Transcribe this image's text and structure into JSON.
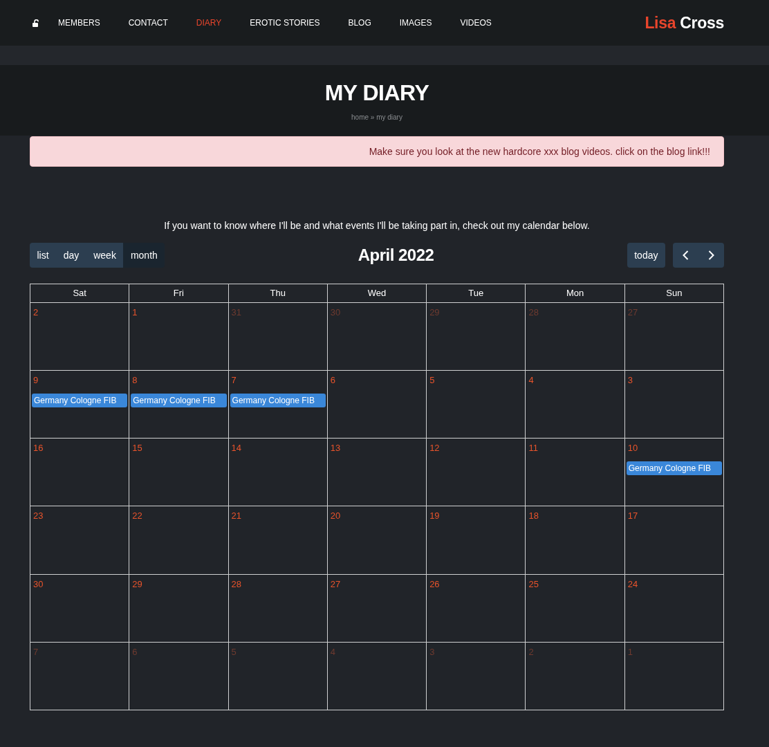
{
  "header": {
    "nav": [
      {
        "label": "MEMBERS",
        "selected": false
      },
      {
        "label": "CONTACT",
        "selected": false
      },
      {
        "label": "DIARY",
        "selected": true
      },
      {
        "label": "EROTIC STORIES",
        "selected": false
      },
      {
        "label": "BLOG",
        "selected": false
      },
      {
        "label": "IMAGES",
        "selected": false
      },
      {
        "label": "VIDEOS",
        "selected": false
      }
    ],
    "logo": {
      "accent": "Lisa",
      "text": "Cross"
    }
  },
  "banner": {
    "title": "MY DIARY",
    "breadcrumb": "home » my diary"
  },
  "alert": {
    "message": "Make sure you look at the new hardcore xxx blog videos. click on the blog link!!!"
  },
  "intro": "If you want to know where I'll be and what events I'll be taking part in, check out my calendar below.",
  "calendar": {
    "views": [
      {
        "label": "list",
        "selected": false
      },
      {
        "label": "day",
        "selected": false
      },
      {
        "label": "week",
        "selected": false
      },
      {
        "label": "month",
        "selected": true
      }
    ],
    "title": "April 2022",
    "today_button": "today",
    "weekdays": [
      "Sat",
      "Fri",
      "Thu",
      "Wed",
      "Tue",
      "Mon",
      "Sun"
    ],
    "weeks": [
      [
        {
          "day": "2",
          "other_month": false
        },
        {
          "day": "1",
          "other_month": false
        },
        {
          "day": "31",
          "other_month": true
        },
        {
          "day": "30",
          "other_month": true
        },
        {
          "day": "29",
          "other_month": true
        },
        {
          "day": "28",
          "other_month": true
        },
        {
          "day": "27",
          "other_month": true
        }
      ],
      [
        {
          "day": "9",
          "other_month": false,
          "events": [
            "Germany Cologne FIB"
          ]
        },
        {
          "day": "8",
          "other_month": false,
          "events": [
            "Germany Cologne FIB"
          ]
        },
        {
          "day": "7",
          "other_month": false,
          "events": [
            "Germany Cologne FIB"
          ]
        },
        {
          "day": "6",
          "other_month": false
        },
        {
          "day": "5",
          "other_month": false
        },
        {
          "day": "4",
          "other_month": false
        },
        {
          "day": "3",
          "other_month": false
        }
      ],
      [
        {
          "day": "16",
          "other_month": false
        },
        {
          "day": "15",
          "other_month": false
        },
        {
          "day": "14",
          "other_month": false
        },
        {
          "day": "13",
          "other_month": false
        },
        {
          "day": "12",
          "other_month": false
        },
        {
          "day": "11",
          "other_month": false
        },
        {
          "day": "10",
          "other_month": false,
          "events": [
            "Germany Cologne FIB"
          ]
        }
      ],
      [
        {
          "day": "23",
          "other_month": false
        },
        {
          "day": "22",
          "other_month": false
        },
        {
          "day": "21",
          "other_month": false
        },
        {
          "day": "20",
          "other_month": false
        },
        {
          "day": "19",
          "other_month": false
        },
        {
          "day": "18",
          "other_month": false
        },
        {
          "day": "17",
          "other_month": false
        }
      ],
      [
        {
          "day": "30",
          "other_month": false
        },
        {
          "day": "29",
          "other_month": false
        },
        {
          "day": "28",
          "other_month": false
        },
        {
          "day": "27",
          "other_month": false
        },
        {
          "day": "26",
          "other_month": false
        },
        {
          "day": "25",
          "other_month": false
        },
        {
          "day": "24",
          "other_month": false
        }
      ],
      [
        {
          "day": "7",
          "other_month": true
        },
        {
          "day": "6",
          "other_month": true
        },
        {
          "day": "5",
          "other_month": true
        },
        {
          "day": "4",
          "other_month": true
        },
        {
          "day": "3",
          "other_month": true
        },
        {
          "day": "2",
          "other_month": true
        },
        {
          "day": "1",
          "other_month": true
        }
      ]
    ]
  }
}
